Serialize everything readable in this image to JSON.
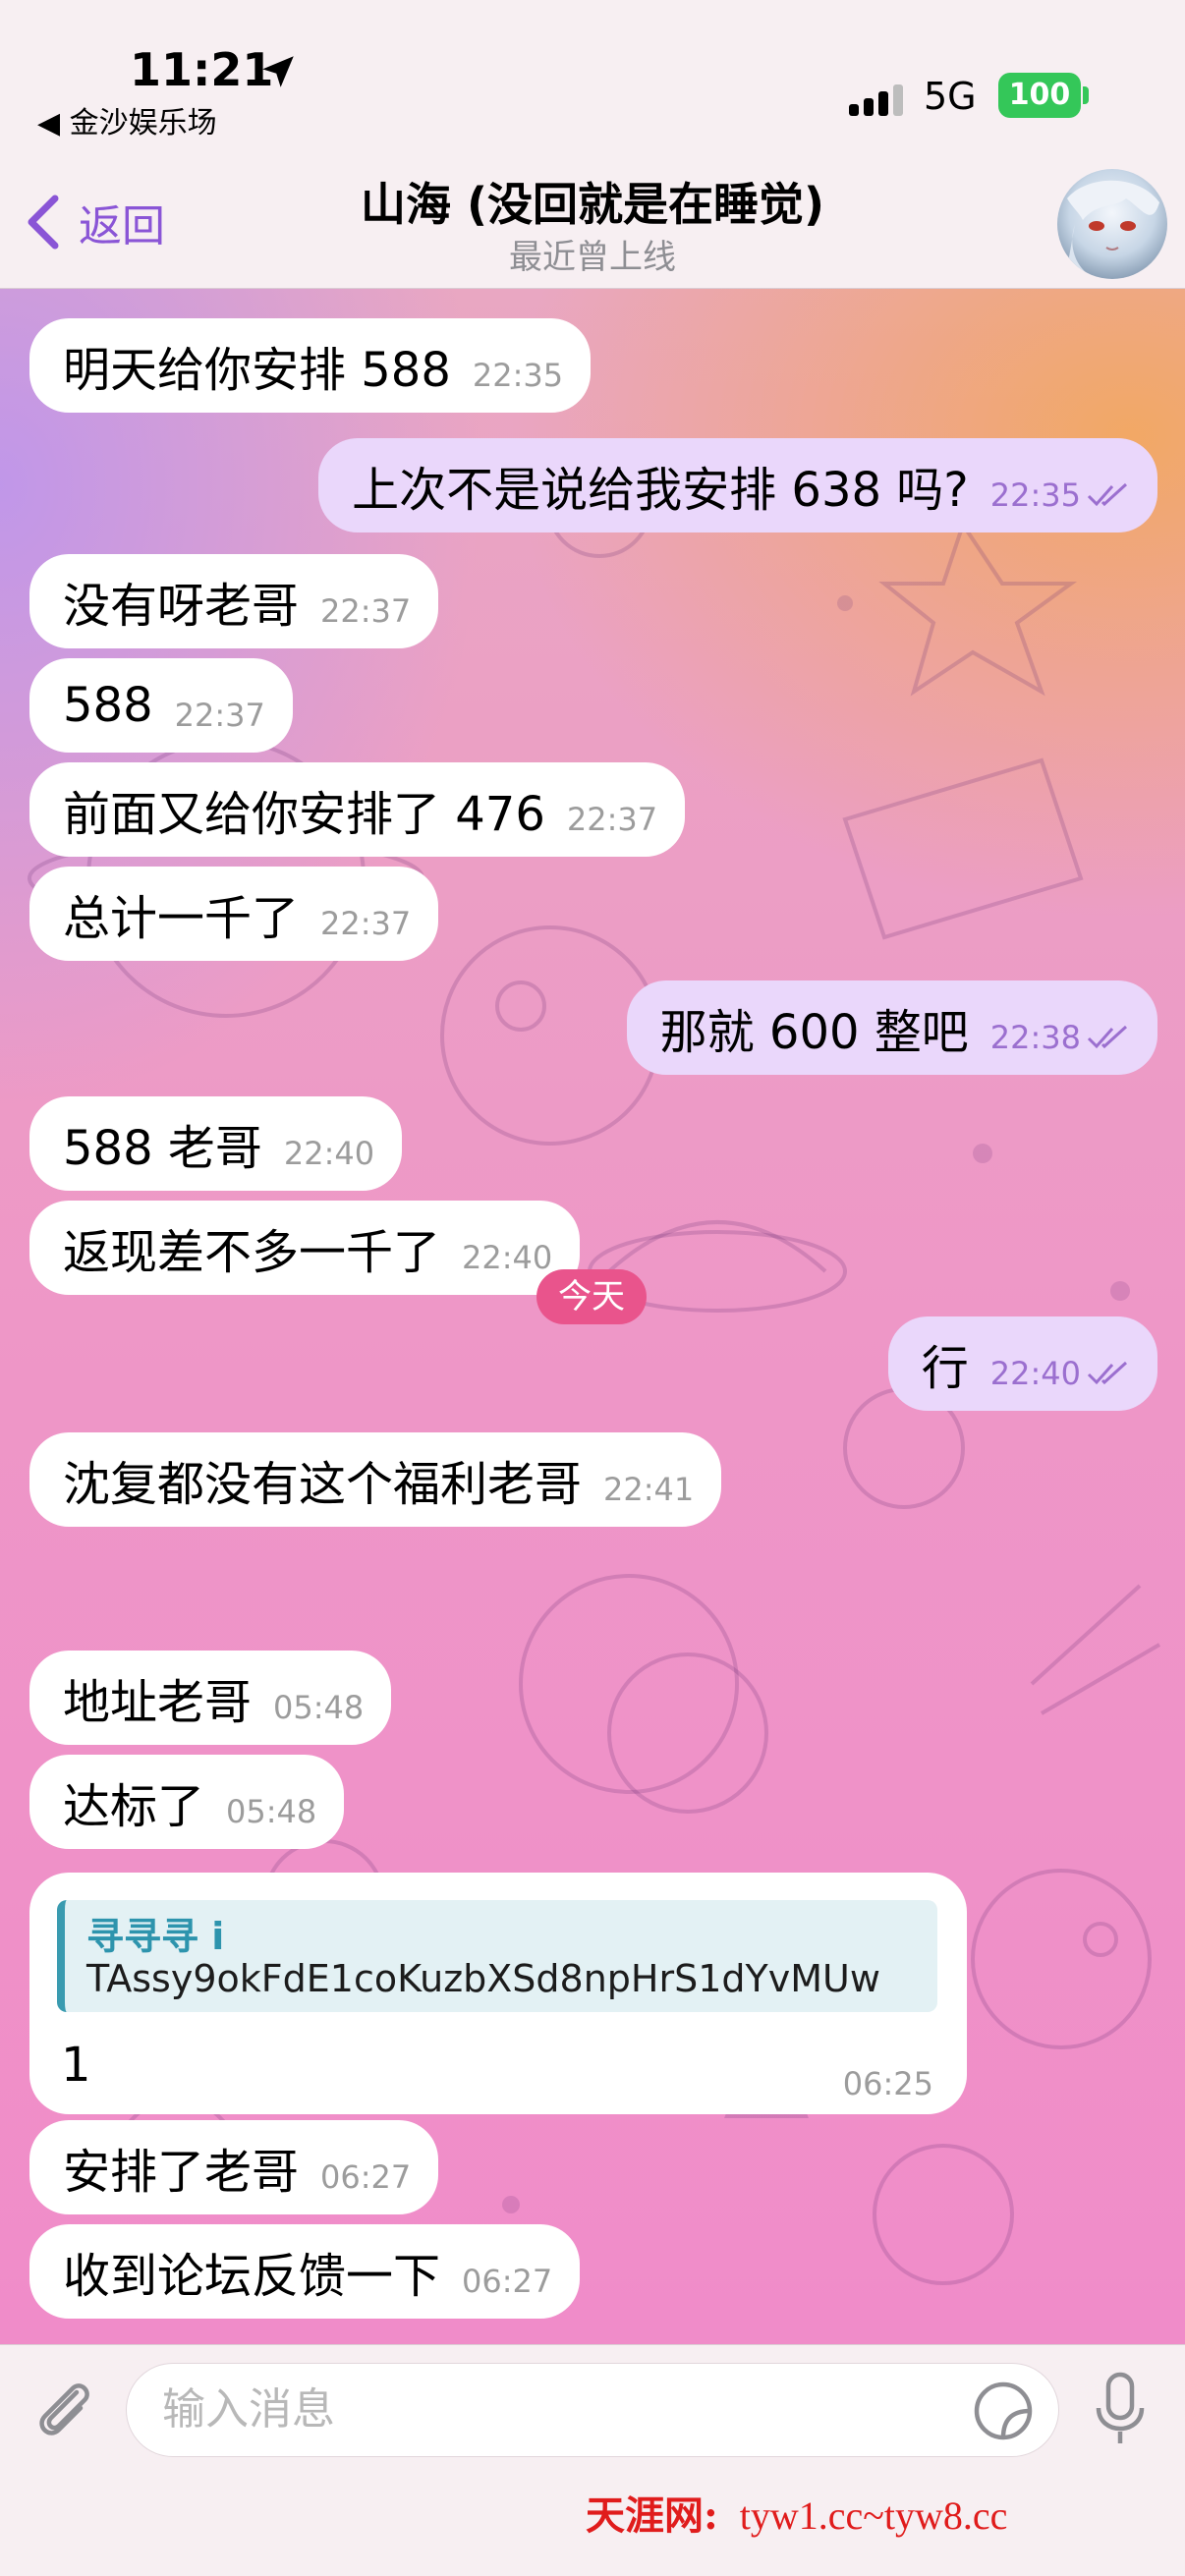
{
  "status_bar": {
    "time": "11:21",
    "back_app": "◀ 金沙娱乐场",
    "network": "5G",
    "battery": "100"
  },
  "header": {
    "back_label": "返回",
    "title": "山海 (没回就是在睡觉)",
    "subtitle": "最近曾上线"
  },
  "messages": [
    {
      "dir": "in",
      "text": "明天给你安排 588",
      "time": "22:35"
    },
    {
      "dir": "out",
      "text": "上次不是说给我安排 638 吗?",
      "time": "22:35"
    },
    {
      "dir": "in",
      "text": "没有呀老哥",
      "time": "22:37"
    },
    {
      "dir": "in",
      "text": "588",
      "time": "22:37"
    },
    {
      "dir": "in",
      "text": "前面又给你安排了 476",
      "time": "22:37"
    },
    {
      "dir": "in",
      "text": "总计一千了",
      "time": "22:37"
    },
    {
      "dir": "out",
      "text": "那就 600 整吧",
      "time": "22:38"
    },
    {
      "dir": "in",
      "text": "588 老哥",
      "time": "22:40"
    },
    {
      "dir": "in",
      "text": "返现差不多一千了",
      "time": "22:40"
    },
    {
      "dir": "out",
      "text": "行",
      "time": "22:40"
    },
    {
      "dir": "in",
      "text": "沈复都没有这个福利老哥",
      "time": "22:41"
    },
    {
      "dir": "in",
      "text": "地址老哥",
      "time": "05:48"
    },
    {
      "dir": "in",
      "text": "达标了",
      "time": "05:48"
    },
    {
      "dir": "in",
      "text": "安排了老哥",
      "time": "06:27"
    },
    {
      "dir": "in",
      "text": "收到论坛反馈一下",
      "time": "06:27"
    }
  ],
  "date_divider": "今天",
  "reply_message": {
    "quote_name": "寻寻寻 i",
    "quote_text": "TAssy9okFdE1coKuzbXSd8npHrS1dYvMUw",
    "text": "1",
    "time": "06:25"
  },
  "input": {
    "placeholder": "输入消息"
  },
  "watermark": {
    "brand": "天涯网:",
    "urls": "tyw1.cc~tyw8.cc"
  },
  "colors": {
    "accent": "#8a55d6",
    "outgoing_bubble": "#ead7fb",
    "date_pill": "#e9548c",
    "quote_bar": "#3a9bb0",
    "battery": "#34c759",
    "watermark": "#e01c1c"
  },
  "icons": {
    "location": "location-arrow-icon",
    "signal": "signal-bars-icon",
    "back": "chevron-left-icon",
    "read": "double-check-icon",
    "attach": "paperclip-icon",
    "sticker": "sticker-icon",
    "mic": "microphone-icon"
  }
}
